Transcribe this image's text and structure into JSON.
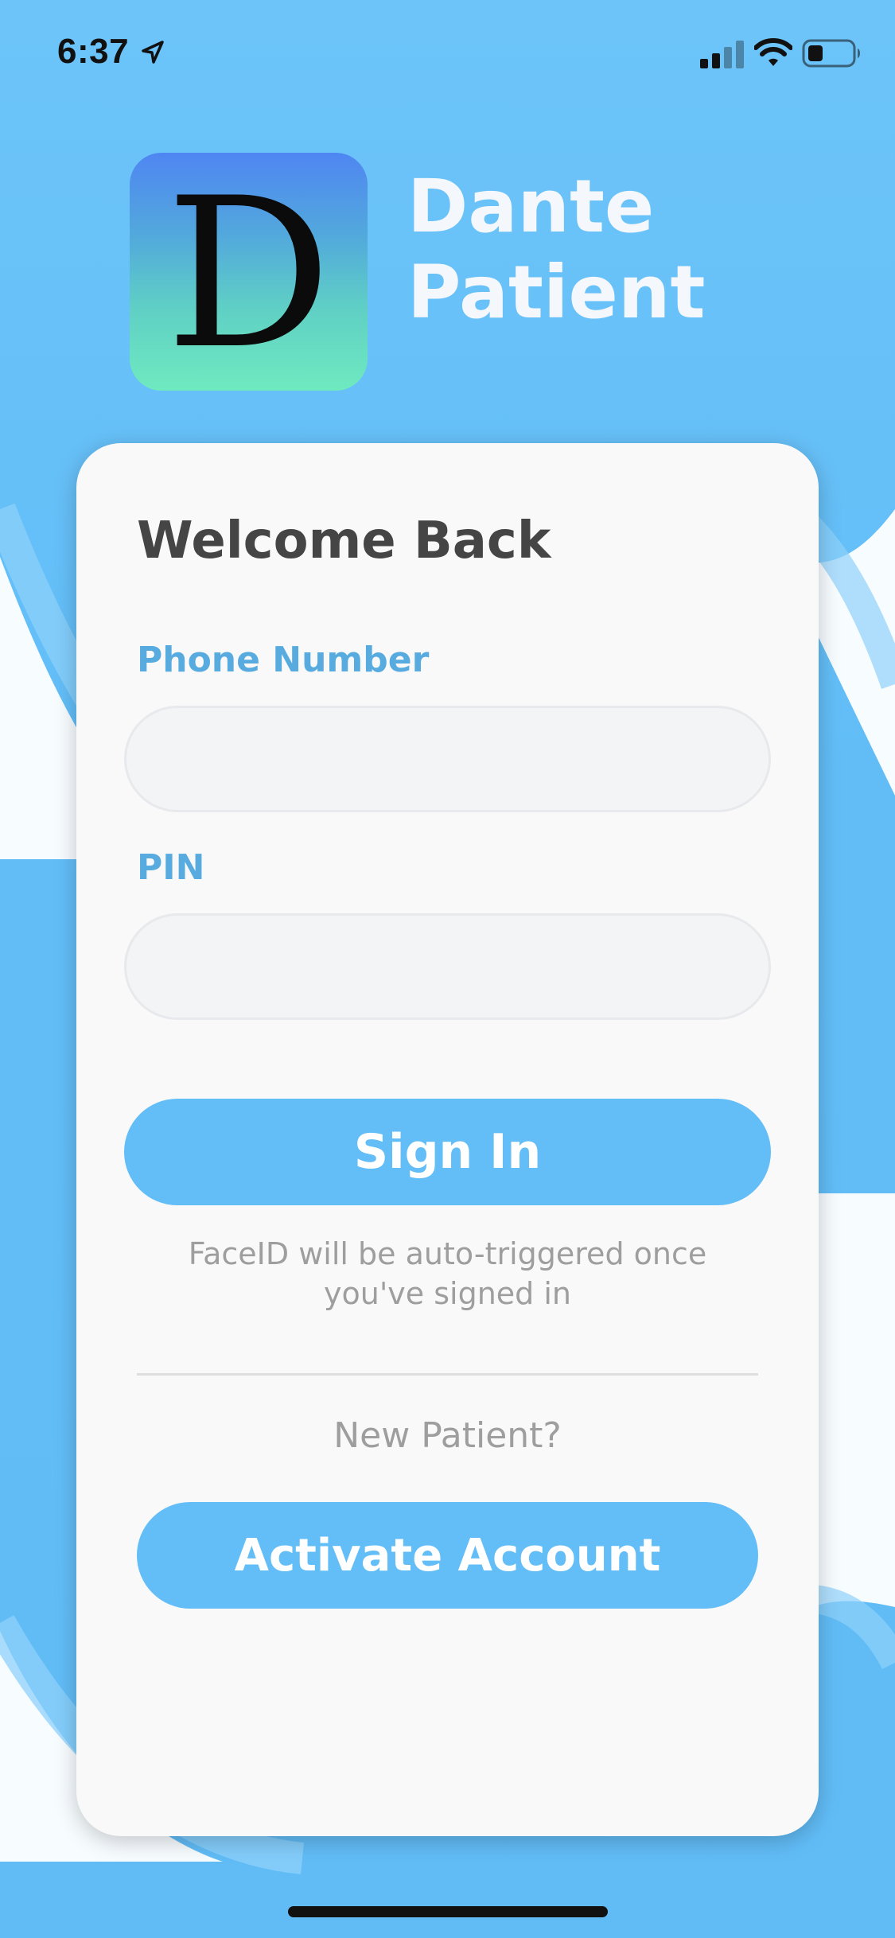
{
  "status_bar": {
    "time": "6:37",
    "icons": [
      "location-arrow-icon",
      "cellular-signal-icon",
      "wifi-icon",
      "battery-icon"
    ]
  },
  "header": {
    "logo_letter": "D",
    "app_name_line1": "Dante",
    "app_name_line2": "Patient"
  },
  "login_card": {
    "title": "Welcome Back",
    "phone_label": "Phone Number",
    "phone_value": "",
    "phone_placeholder": "",
    "pin_label": "PIN",
    "pin_value": "",
    "pin_placeholder": "",
    "sign_in_label": "Sign In",
    "faceid_note": "FaceID will be auto-triggered once you've signed in",
    "new_patient_text": "New Patient?",
    "activate_label": "Activate Account"
  },
  "colors": {
    "background": "#64bef7",
    "accent": "#63bdf6",
    "label": "#58abdf",
    "card": "#f9f9fa",
    "title_text": "#454545",
    "muted_text": "#9e9e9e"
  }
}
